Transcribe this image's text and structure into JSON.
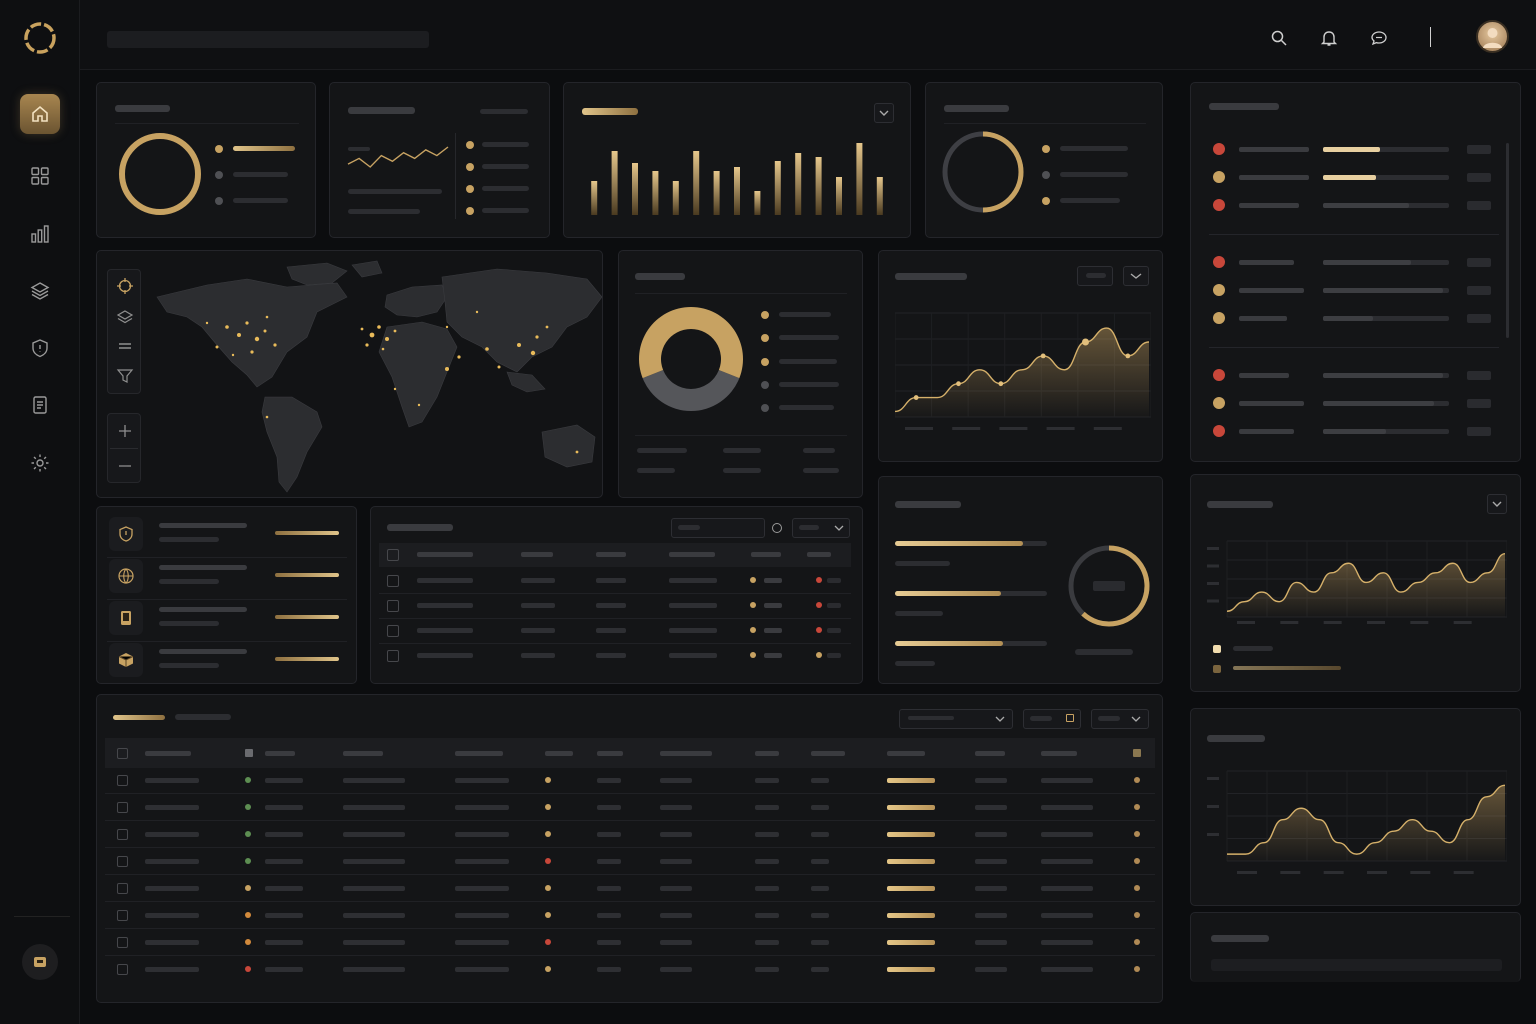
{
  "app": {
    "brand_icon": "ring-logo-icon",
    "accent_color": "#c7a262",
    "alert_color": "#c8473a",
    "success_color": "#5d8e52"
  },
  "sidebar": {
    "items": [
      {
        "icon": "home-icon",
        "active": true
      },
      {
        "icon": "grid-icon",
        "active": false
      },
      {
        "icon": "bar-chart-icon",
        "active": false
      },
      {
        "icon": "layers-icon",
        "active": false
      },
      {
        "icon": "shield-icon",
        "active": false
      },
      {
        "icon": "document-icon",
        "active": false
      },
      {
        "icon": "gear-icon",
        "active": false
      }
    ],
    "bottom_icon": "box-icon"
  },
  "topbar": {
    "icons": [
      "search-icon",
      "bell-icon",
      "chat-icon"
    ],
    "avatar_icon": "user-avatar"
  },
  "widgets": {
    "donut_1": {
      "fill": 1.0
    },
    "sparkline": {
      "values": [
        3,
        5,
        2,
        6,
        4,
        7,
        5,
        8,
        6,
        9
      ]
    },
    "bar_chart": {
      "values": [
        34,
        64,
        52,
        44,
        34,
        64,
        44,
        48,
        24,
        54,
        62,
        58,
        38,
        72,
        38
      ]
    },
    "donut_2": {
      "fill": 0.5
    },
    "pie": {
      "gold_fraction": 0.62
    },
    "area_chart_1": {
      "values": [
        2,
        3,
        3,
        4,
        5,
        4,
        5,
        6,
        5,
        7,
        8,
        6,
        7
      ]
    },
    "ring_gauge": {
      "fill": 0.62
    },
    "area_chart_2": {
      "values": [
        3,
        4,
        5,
        4,
        6,
        5,
        7,
        8,
        6,
        7,
        5,
        6,
        7,
        8,
        6,
        7,
        9
      ]
    },
    "area_chart_3": {
      "values": [
        3,
        3,
        4,
        6,
        7,
        6,
        4,
        3,
        4,
        5,
        6,
        5,
        4,
        6,
        8,
        9
      ]
    },
    "progress_bars": [
      0.84,
      0.7,
      0.71
    ],
    "list_icons": [
      "shield-icon",
      "globe-icon",
      "phone-icon",
      "cube-icon"
    ],
    "map_tools": [
      "crosshair-icon",
      "layers-icon",
      "minus-icon",
      "filter-icon",
      "plus-icon",
      "minus-icon"
    ]
  }
}
